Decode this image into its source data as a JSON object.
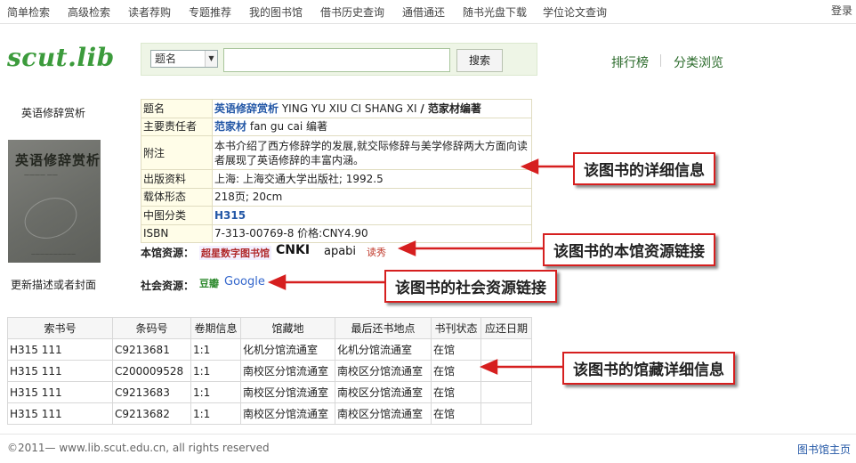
{
  "nav": {
    "items": [
      "简单检索",
      "高级检索",
      "读者荐购",
      "专题推荐",
      "我的图书馆",
      "借书历史查询",
      "通借通还",
      "随书光盘下载",
      "学位论文查询"
    ],
    "login": "登录"
  },
  "logo": "scut.lib",
  "search": {
    "field": "题名",
    "value": "",
    "button": "搜索"
  },
  "links": {
    "ranking": "排行榜",
    "browse": "分类浏览"
  },
  "book": {
    "side_title": "英语修辞赏析",
    "cover_title": "英语修辞赏析",
    "update_link": "更新描述或者封面",
    "details": {
      "title_label": "题名",
      "title_cn": "英语修辞赏析",
      "title_pinyin": "YING YU XIU CI SHANG XI",
      "title_author": "/ 范家材编著",
      "author_label": "主要责任者",
      "author_cn": "范家材",
      "author_pinyin": "fan gu cai 编著",
      "note_label": "附注",
      "note": "本书介绍了西方修辞学的发展,就交际修辞与美学修辞两大方面向读者展现了英语修辞的丰富内涵。",
      "pub_label": "出版资料",
      "pub": "上海: 上海交通大学出版社; 1992.5",
      "form_label": "载体形态",
      "form": "218页; 20cm",
      "class_label": "中图分类",
      "class": "H315",
      "isbn_label": "ISBN",
      "isbn": "7-313-00769-8 价格:CNY4.90"
    }
  },
  "resources": {
    "local_label": "本馆资源：",
    "local": [
      "超星数字图书馆",
      "CNKI",
      "apabi",
      "读秀"
    ],
    "social_label": "社会资源：",
    "social": [
      "豆瓣",
      "Google"
    ]
  },
  "holdings": {
    "headers": [
      "索书号",
      "条码号",
      "卷期信息",
      "馆藏地",
      "最后还书地点",
      "书刊状态",
      "应还日期"
    ],
    "rows": [
      [
        "H315 111",
        "C9213681",
        "1:1",
        "化机分馆流通室",
        "化机分馆流通室",
        "在馆",
        ""
      ],
      [
        "H315 111",
        "C200009528",
        "1:1",
        "南校区分馆流通室",
        "南校区分馆流通室",
        "在馆",
        ""
      ],
      [
        "H315 111",
        "C9213683",
        "1:1",
        "南校区分馆流通室",
        "南校区分馆流通室",
        "在馆",
        ""
      ],
      [
        "H315 111",
        "C9213682",
        "1:1",
        "南校区分馆流通室",
        "南校区分馆流通室",
        "在馆",
        ""
      ]
    ]
  },
  "annotations": {
    "detail": "该图书的详细信息",
    "local": "该图书的本馆资源链接",
    "social": "该图书的社会资源链接",
    "holdings": "该图书的馆藏详细信息"
  },
  "footer": {
    "copyright": "©2011— www.lib.scut.edu.cn, all rights reserved",
    "home": "图书馆主页"
  },
  "colors": {
    "logo": "#3c9b3c",
    "annotation_border": "#d61f1f",
    "link": "#2357a6"
  }
}
